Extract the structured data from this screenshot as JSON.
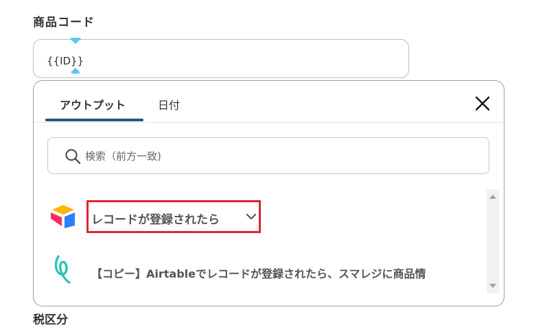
{
  "field": {
    "label": "商品コード",
    "value": "{{ID}}"
  },
  "panel": {
    "tabs": [
      {
        "label": "アウトプット",
        "active": true
      },
      {
        "label": "日付",
        "active": false
      }
    ],
    "search": {
      "placeholder": "検索（前方一致)"
    },
    "trigger": {
      "label": "レコードが登録されたら",
      "icon": "airtable-logo",
      "highlight_color": "#e0232e"
    },
    "flow": {
      "label": "【コピー】Airtableでレコードが登録されたら、スマレジに商品情",
      "icon": "yoom-logo"
    }
  },
  "next_field": {
    "label": "税区分"
  },
  "colors": {
    "tab_underline": "#1f5c7a",
    "cursor_handle": "#4fc3f7"
  }
}
